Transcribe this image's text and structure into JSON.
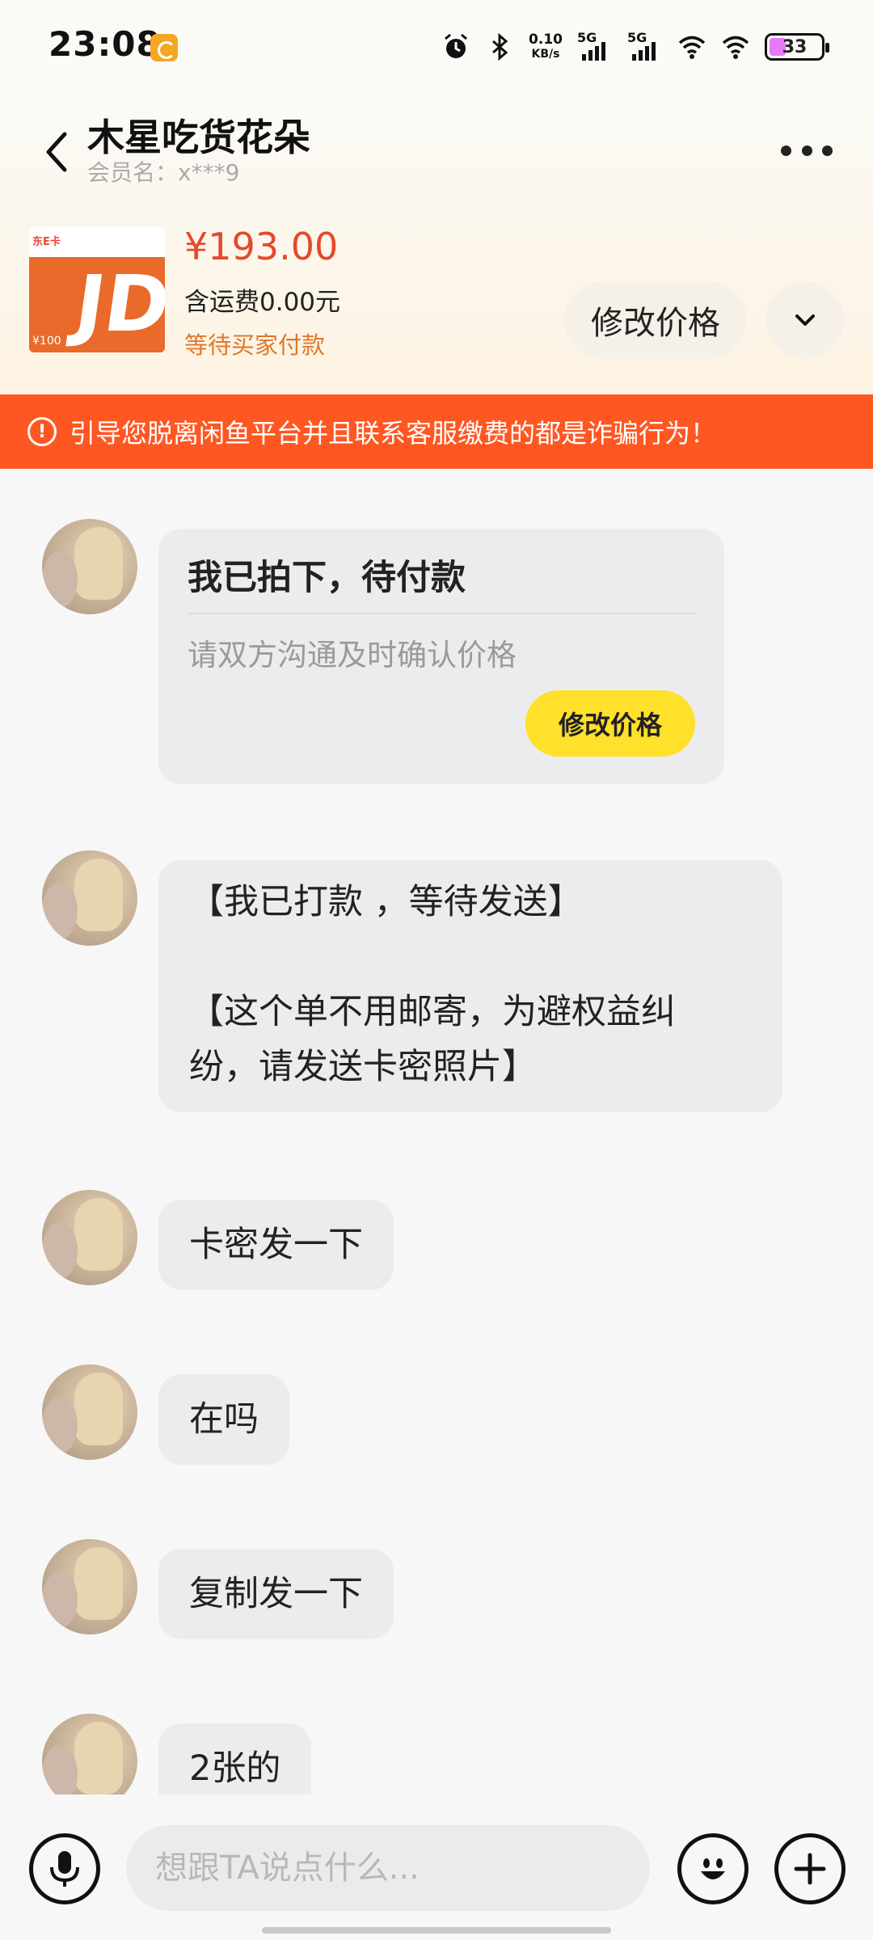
{
  "status_bar": {
    "time": "23:08",
    "net_speed_value": "0.10",
    "net_speed_unit": "KB/s",
    "signal_1_label": "5G",
    "signal_2_label": "5G",
    "battery": "33"
  },
  "header": {
    "title": "木星吃货花朵",
    "member": "会员名：x***9",
    "more_icon": "more-dots-icon",
    "back_icon": "chevron-left-icon"
  },
  "product": {
    "image_brand": "东E卡",
    "image_logo": "JD",
    "image_value": "¥100",
    "price": "¥193.00",
    "shipping": "含运费0.00元",
    "status": "等待买家付款",
    "modify_price_label": "修改价格",
    "expand_icon": "chevron-down-icon"
  },
  "warning": {
    "icon": "!",
    "text": "引导您脱离闲鱼平台并且联系客服缴费的都是诈骗行为！"
  },
  "messages": {
    "order_card": {
      "title": "我已拍下，待付款",
      "subtitle": "请双方沟通及时确认价格",
      "button_label": "修改价格"
    },
    "m1": "【我已打款 ，等待发送】\n\n【这个单不用邮寄，为避权益纠\n纷，请发送卡密照片】",
    "m2": "卡密发一下",
    "m3": "在吗",
    "m4": "复制发一下",
    "m5": "2张的"
  },
  "input_bar": {
    "placeholder": "想跟TA说点什么...",
    "mic_icon": "microphone-icon",
    "emoji_icon": "emoji-icon",
    "plus_icon": "plus-icon"
  },
  "colors": {
    "price": "#e34a2a",
    "warning_bg": "#ff5722",
    "card_button": "#ffe02a",
    "status_text": "#e0772c"
  }
}
